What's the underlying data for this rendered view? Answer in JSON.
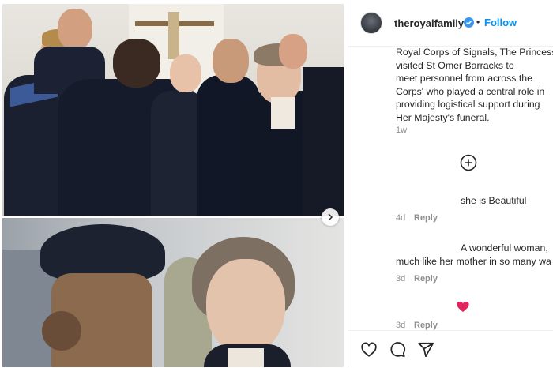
{
  "post": {
    "username": "theroyalfamily",
    "separator": "•",
    "follow_label": "Follow",
    "caption": "Royal Corps of Signals, The Princess\nvisited St Omer Barracks to\nmeet personnel from across the\nCorps' who played a central role in\nproviding logistical support during\nHer Majesty's funeral.",
    "caption_age": "1w",
    "load_more_icon": "plus-circle-icon"
  },
  "comments": [
    {
      "text": "she is Beautiful",
      "age": "4d",
      "reply_label": "Reply"
    },
    {
      "text": "A wonderful woman,\nmuch like her mother in so many wa",
      "age": "3d",
      "reply_label": "Reply"
    },
    {
      "age": "3d",
      "reply_label": "Reply"
    }
  ],
  "actions": {
    "icons": [
      "heart-icon",
      "comment-icon",
      "share-icon"
    ]
  },
  "colors": {
    "follow": "#0095f6",
    "verified": "#3897f0",
    "secondary_text": "#8e8e8e",
    "heart_emoji": "#e0245e"
  }
}
